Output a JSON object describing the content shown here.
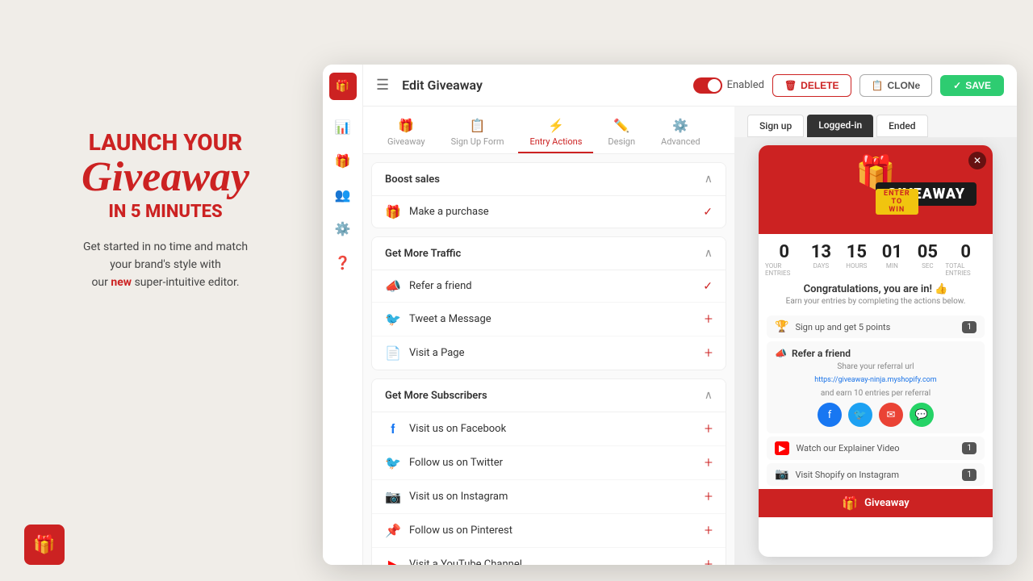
{
  "marketing": {
    "launch": "Launch Your",
    "giveaway": "Giveaway",
    "in5min": "IN 5 MINUTES",
    "desc_part1": "Get started in no time and match",
    "desc_part2": "your brand's style with",
    "desc_part3": "our",
    "desc_new": "new",
    "desc_part4": "super-intuitive editor."
  },
  "header": {
    "menu_icon": "☰",
    "title": "Edit Giveaway",
    "toggle_label": "Enabled",
    "btn_delete": "DELETE",
    "btn_clone": "CLONe",
    "btn_save": "SAVE"
  },
  "tabs": [
    {
      "id": "giveaway",
      "label": "Giveaway",
      "icon": "🎁"
    },
    {
      "id": "signup",
      "label": "Sign Up Form",
      "icon": "📋"
    },
    {
      "id": "entry",
      "label": "Entry Actions",
      "icon": "⚡",
      "active": true
    },
    {
      "id": "design",
      "label": "Design",
      "icon": "✏️"
    },
    {
      "id": "advanced",
      "label": "Advanced",
      "icon": "⚙️"
    }
  ],
  "sections": {
    "boost_sales": {
      "title": "Boost sales",
      "items": [
        {
          "icon": "🎁",
          "label": "Make a purchase",
          "status": "check"
        }
      ]
    },
    "more_traffic": {
      "title": "Get More Traffic",
      "items": [
        {
          "icon": "📣",
          "label": "Refer a friend",
          "status": "check"
        },
        {
          "icon": "twitter",
          "label": "Tweet a Message",
          "status": "add"
        },
        {
          "icon": "page",
          "label": "Visit a Page",
          "status": "add"
        }
      ]
    },
    "more_subscribers": {
      "title": "Get More Subscribers",
      "items": [
        {
          "icon": "facebook",
          "label": "Visit us on Facebook",
          "status": "add"
        },
        {
          "icon": "twitter",
          "label": "Follow us on Twitter",
          "status": "add"
        },
        {
          "icon": "instagram",
          "label": "Visit us on Instagram",
          "status": "add"
        },
        {
          "icon": "pinterest",
          "label": "Follow us on Pinterest",
          "status": "add"
        },
        {
          "icon": "youtube",
          "label": "Visit a YouTube Channel",
          "status": "add"
        }
      ]
    }
  },
  "preview_tabs": [
    {
      "label": "Sign up",
      "active": false
    },
    {
      "label": "Logged-in",
      "active": true
    },
    {
      "label": "Ended",
      "active": false
    }
  ],
  "widget": {
    "banner_text": "GIVEAWAY",
    "banner_sub": "ENTER TO WIN",
    "entries_label": "Your entries",
    "days": "13",
    "hours": "15",
    "min": "01",
    "sec": "05",
    "total_label": "Total entries",
    "your_entries": "0",
    "total_entries": "0",
    "congrats": "Congratulations, you are in! 👍",
    "sub_text": "Earn your entries by completing the actions below.",
    "signup_action": "Sign up and get 5 points",
    "signup_badge": "1",
    "refer_title": "Refer a friend",
    "refer_desc": "Share your referral url",
    "refer_url": "https://giveaway-ninja.myshopify.com",
    "refer_earn": "and earn 10 entries per referral",
    "video_label": "Watch our Explainer Video",
    "video_badge": "1",
    "instagram_label": "Visit Shopify on Instagram",
    "instagram_badge": "1",
    "footer_label": "Giveaway"
  },
  "sidebar_icons": [
    "📊",
    "🎁",
    "👥",
    "⚙️",
    "❓"
  ]
}
